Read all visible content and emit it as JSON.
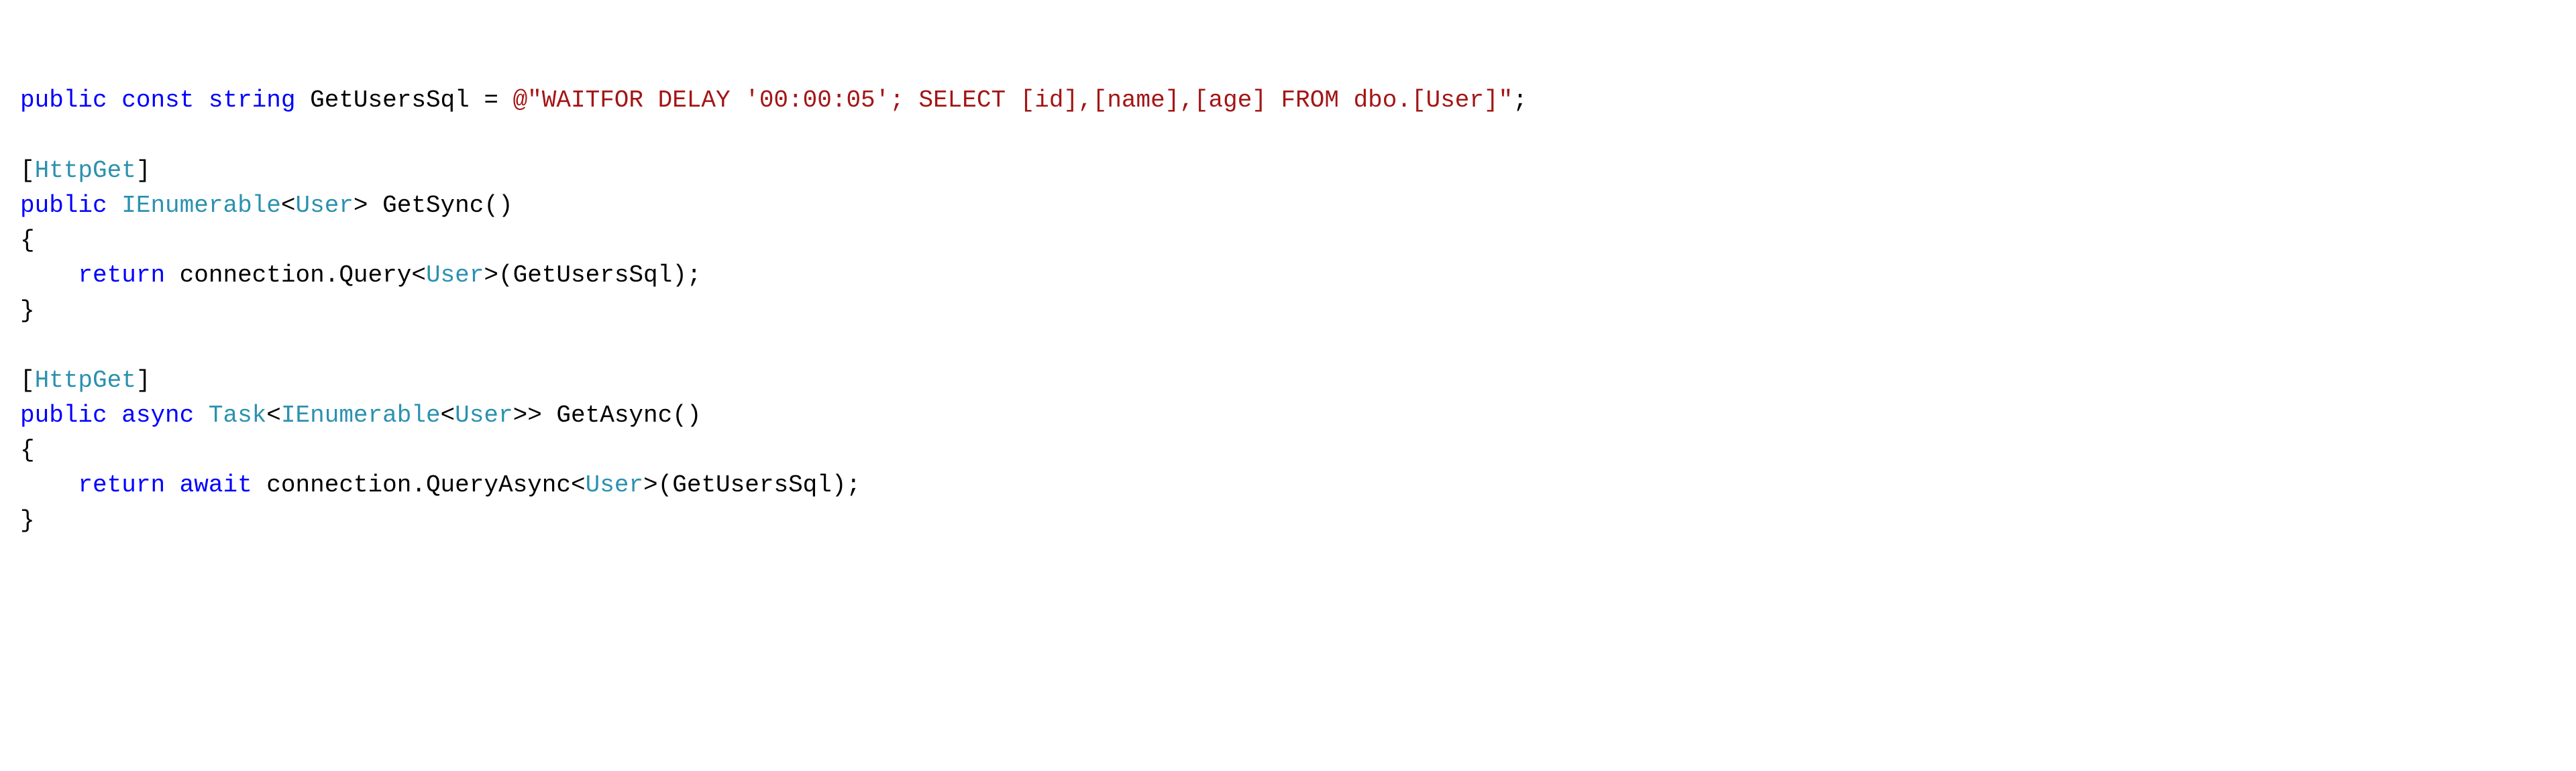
{
  "code": {
    "kw_public": "public",
    "kw_const": "const",
    "kw_string": "string",
    "kw_return": "return",
    "kw_async": "async",
    "kw_await": "await",
    "id_GetUsersSql": "GetUsersSql",
    "op_eq": " = ",
    "at": "@",
    "str_sql": "\"WAITFOR DELAY '00:00:05'; SELECT [id],[name],[age] FROM dbo.[User]\"",
    "semi": ";",
    "lbracket": "[",
    "rbracket": "]",
    "attr_HttpGet": "HttpGet",
    "type_IEnumerable": "IEnumerable",
    "type_User": "User",
    "type_Task": "Task",
    "lt": "<",
    "gt": ">",
    "id_GetSync": "GetSync",
    "id_GetAsync": "GetAsync",
    "parens": "()",
    "lbrace": "{",
    "rbrace": "}",
    "id_connection": "connection",
    "dot": ".",
    "id_Query": "Query",
    "id_QueryAsync": "QueryAsync",
    "lparen": "(",
    "rparen": ")",
    "indent": "    ",
    "space": " "
  }
}
